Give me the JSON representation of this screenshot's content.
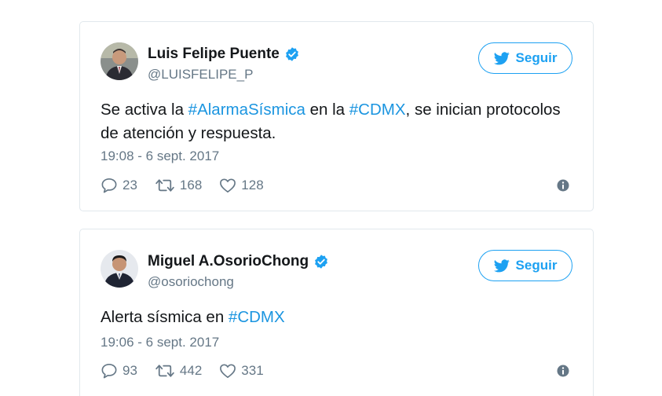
{
  "colors": {
    "accent": "#1da1f2",
    "hashtag": "#1b95e0",
    "muted": "#657786",
    "text": "#14171a",
    "border": "#e1e8ed"
  },
  "tweets": [
    {
      "user_name": "Luis Felipe Puente",
      "handle": "@LUISFELIPE_P",
      "verified": true,
      "follow_label": "Seguir",
      "text_parts": [
        {
          "text": "Se activa la ",
          "hashtag": false
        },
        {
          "text": "#AlarmaSísmica",
          "hashtag": true
        },
        {
          "text": " en la ",
          "hashtag": false
        },
        {
          "text": "#CDMX",
          "hashtag": true
        },
        {
          "text": ", se inician protocolos de atención y respuesta.",
          "hashtag": false
        }
      ],
      "timestamp": "19:08 - 6 sept. 2017",
      "replies": "23",
      "retweets": "168",
      "likes": "128",
      "icons": [
        "comment-icon",
        "retweet-icon",
        "heart-icon",
        "info-icon"
      ]
    },
    {
      "user_name": "Miguel A.OsorioChong",
      "handle": "@osoriochong",
      "verified": true,
      "follow_label": "Seguir",
      "text_parts": [
        {
          "text": "Alerta sísmica en ",
          "hashtag": false
        },
        {
          "text": "#CDMX",
          "hashtag": true
        }
      ],
      "timestamp": "19:06 - 6 sept. 2017",
      "replies": "93",
      "retweets": "442",
      "likes": "331",
      "icons": [
        "comment-icon",
        "retweet-icon",
        "heart-icon",
        "info-icon"
      ]
    }
  ]
}
